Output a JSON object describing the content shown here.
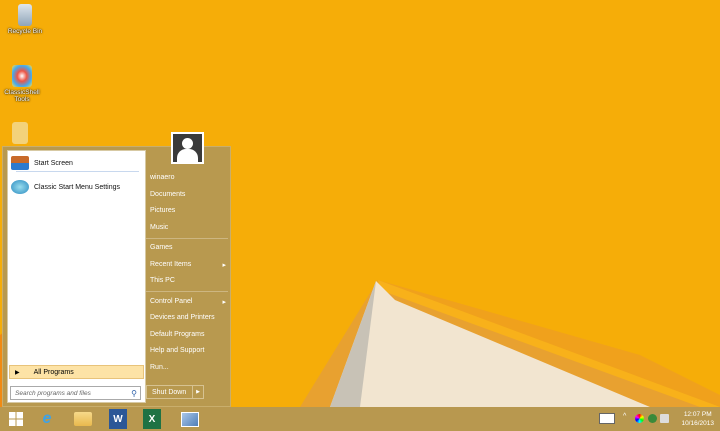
{
  "desktop": {
    "icons": [
      {
        "label": "Recycle Bin"
      },
      {
        "label": "ClassicShell Tools"
      }
    ]
  },
  "start_menu": {
    "left": {
      "items": [
        {
          "label": "Start Screen"
        },
        {
          "label": "Classic Start Menu Settings"
        }
      ],
      "all_programs": "All Programs",
      "search_placeholder": "Search programs and files"
    },
    "right": {
      "user": "winaero",
      "items": [
        {
          "label": "Documents"
        },
        {
          "label": "Pictures"
        },
        {
          "label": "Music"
        },
        {
          "label": "Games"
        },
        {
          "label": "Recent Items"
        },
        {
          "label": "This PC"
        },
        {
          "label": "Control Panel"
        },
        {
          "label": "Devices and Printers"
        },
        {
          "label": "Default Programs"
        },
        {
          "label": "Help and Support"
        },
        {
          "label": "Run..."
        }
      ],
      "shutdown": "Shut Down"
    }
  },
  "taskbar": {
    "apps": [
      "start",
      "internet-explorer",
      "file-explorer",
      "word",
      "excel",
      "snipping-tool"
    ],
    "time": "12:07 PM",
    "date": "10/16/2013"
  },
  "colors": {
    "wallpaper": "#f6ad08",
    "menu": "#b8994f",
    "taskbar": "#b8984f"
  }
}
